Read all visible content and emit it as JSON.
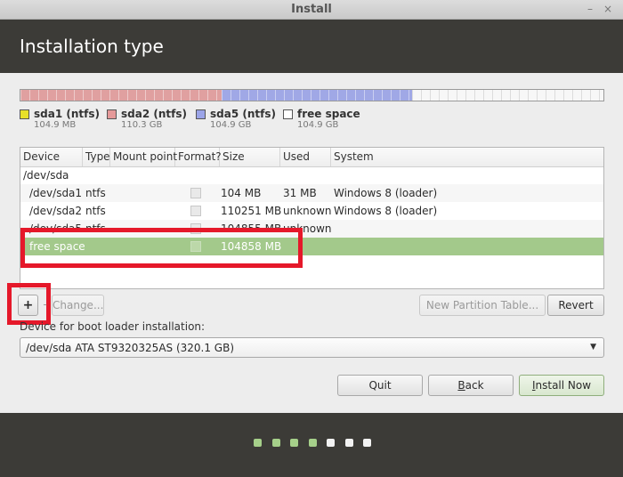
{
  "window": {
    "title": "Install",
    "minimize_glyph": "–",
    "close_glyph": "×"
  },
  "header": {
    "title": "Installation type"
  },
  "partition_bar": {
    "segments": [
      {
        "name": "sda1",
        "fraction": 0.0003,
        "color": "#e0d63a"
      },
      {
        "name": "sda2",
        "fraction": 0.344,
        "color": "#e0a0a0"
      },
      {
        "name": "sda5",
        "fraction": 0.327,
        "color": "#a0a8e6"
      },
      {
        "name": "free",
        "fraction": 0.3287,
        "color": "#f7f7f7"
      }
    ]
  },
  "legend": [
    {
      "name": "sda1 (ntfs)",
      "size": "104.9 MB",
      "color": "#e8e02a"
    },
    {
      "name": "sda2 (ntfs)",
      "size": "110.3 GB",
      "color": "#e59999"
    },
    {
      "name": "sda5 (ntfs)",
      "size": "104.9 GB",
      "color": "#9ba4e8"
    },
    {
      "name": "free space",
      "size": "104.9 GB",
      "color": "#ffffff"
    }
  ],
  "table": {
    "columns": [
      "Device",
      "Type",
      "Mount point",
      "Format?",
      "Size",
      "Used",
      "System"
    ],
    "group": "/dev/sda",
    "rows": [
      {
        "device": "/dev/sda1",
        "type": "ntfs",
        "mount": "",
        "size": "104 MB",
        "used": "31 MB",
        "system": "Windows 8 (loader)"
      },
      {
        "device": "/dev/sda2",
        "type": "ntfs",
        "mount": "",
        "size": "110251 MB",
        "used": "unknown",
        "system": "Windows 8 (loader)"
      },
      {
        "device": "/dev/sda5",
        "type": "ntfs",
        "mount": "",
        "size": "104855 MB",
        "used": "unknown",
        "system": ""
      },
      {
        "device": "free space",
        "type": "",
        "mount": "",
        "size": "104858 MB",
        "used": "",
        "system": ""
      }
    ]
  },
  "toolbar": {
    "add_label": "+",
    "remove_label": "-",
    "change_label": "Change...",
    "new_table_label": "New Partition Table...",
    "revert_label": "Revert"
  },
  "boot_loader": {
    "label": "Device for boot loader installation:",
    "value": "/dev/sda   ATA ST9320325AS (320.1 GB)"
  },
  "actions": {
    "quit_label": "Quit",
    "back_accel": "B",
    "back_rest": "ack",
    "install_accel": "I",
    "install_rest": "nstall Now"
  },
  "progress": {
    "total_steps": 7,
    "current_step": 4,
    "done_color": "#a6d08a",
    "todo_color": "#f2f2f2"
  }
}
